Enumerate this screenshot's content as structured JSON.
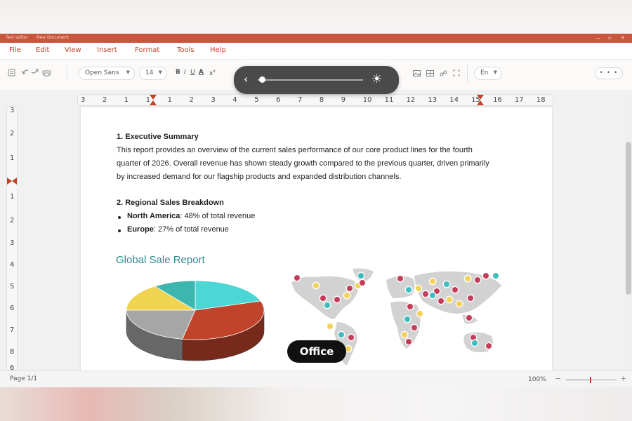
{
  "window": {
    "title_left": "Text editor",
    "title_doc": "New Document"
  },
  "menu": [
    "File",
    "Edit",
    "View",
    "Insert",
    "Format",
    "Tools",
    "Help"
  ],
  "toolbar": {
    "font": "Open Sans",
    "size": "14",
    "bold": "B",
    "italic": "I",
    "underline": "U",
    "font_color": "A",
    "clear_format": "x",
    "clear_format_sup": "x",
    "language": "En",
    "more": "• • •",
    "icons": [
      "save-icon",
      "undo-icon",
      "redo-icon",
      "print-icon",
      "image-icon",
      "table-icon",
      "link-icon",
      "fullscreen-icon"
    ]
  },
  "overlay": {
    "back_icon": "chevron-left-icon",
    "brightness_icon": "sun-icon",
    "brightness": 0.03
  },
  "ruler": {
    "h_numbers": [
      "3",
      "2",
      "1",
      "1",
      "1",
      "2",
      "3",
      "4",
      "5",
      "6",
      "7",
      "8",
      "9",
      "10",
      "11",
      "12",
      "13",
      "14",
      "15",
      "16",
      "17",
      "18"
    ],
    "v_numbers": [
      "3",
      "2",
      "1",
      "1",
      "2",
      "3",
      "4",
      "5",
      "6",
      "7",
      "8",
      "6"
    ]
  },
  "document": {
    "h1": "1. Executive Summary",
    "p1_lines": [
      "This report provides an overview of the current sales performance of our core product lines for the fourth",
      "quarter of 2026. Overall revenue has shown steady growth compared to the previous quarter, driven primarily",
      "by increased demand for our flagship products and expanded distribution channels."
    ],
    "h2": "2. Regional Sales Breakdown",
    "bullets": [
      {
        "region": "North America",
        "rest": ": 48% of total revenue"
      },
      {
        "region": "Europe",
        "rest": ": 27% of total revenue"
      }
    ],
    "report_title": "Global Sale Report"
  },
  "chart_data": {
    "type": "pie",
    "slices": [
      {
        "label": "",
        "value": 0.2,
        "color": "#4dd6d6"
      },
      {
        "label": "",
        "value": 0.33,
        "color": "#c0432b"
      },
      {
        "label": "",
        "value": 0.22,
        "color": "#a6a6a6"
      },
      {
        "label": "",
        "value": 0.15,
        "color": "#f0d34e"
      },
      {
        "label": "",
        "value": 0.1,
        "color": "#3eb6b0"
      }
    ]
  },
  "map": {
    "land_color": "#d2d2d2",
    "dot_colors": [
      "#c53d5a",
      "#3ebdc0",
      "#f3d258"
    ]
  },
  "badge": "Office",
  "status": {
    "page": "Page  1/1",
    "zoom": "100%",
    "minus": "−",
    "plus": "+",
    "zoom_fraction": 0.48
  },
  "colors": {
    "accent": "#c9553d",
    "menu_text": "#c0432b",
    "title_teal": "#2e8a91"
  }
}
